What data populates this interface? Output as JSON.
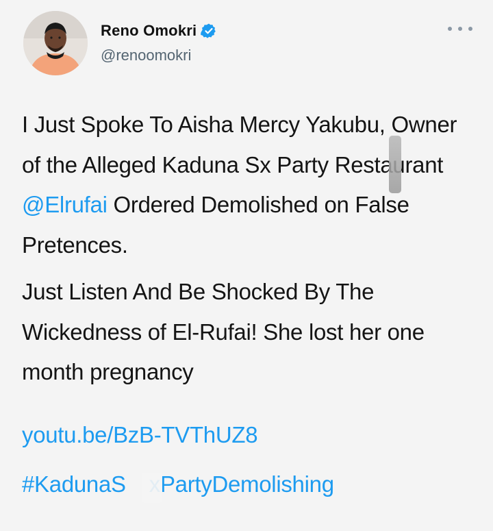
{
  "author": {
    "display_name": "Reno Omokri",
    "handle": "@renoomokri"
  },
  "tweet": {
    "para1_a": "I Just Spoke To Aisha Mercy Yakubu, Owner of the Alleged Kaduna S",
    "para1_b": "x Party Restaurant ",
    "para1_mention": "@Elrufai",
    "para1_c": " Ordered Demolished on False Pretences.",
    "para2": "Just Listen And Be Shocked By The Wickedness of El-Rufai! She lost her one month pregnancy",
    "link": "youtu.be/BzB-TVThUZ8",
    "hashtag_a": "#KadunaS",
    "hashtag_b": "xPartyDemolishing"
  },
  "colors": {
    "link": "#1d9bf0",
    "text": "#141414",
    "secondary": "#536471"
  },
  "icons": [
    "verified-badge-icon",
    "more-options-icon"
  ]
}
